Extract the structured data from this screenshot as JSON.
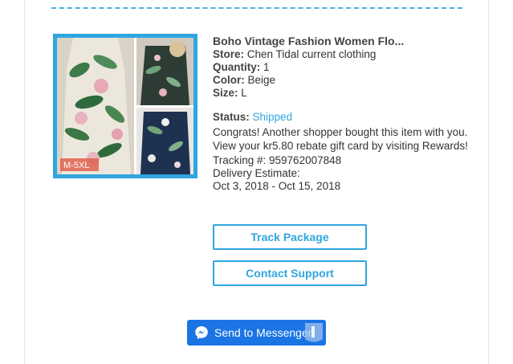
{
  "order_item": {
    "title": "Boho Vintage Fashion Women Flo...",
    "store_label": "Store:",
    "store": "Chen Tidal current clothing",
    "quantity_label": "Quantity:",
    "quantity": "1",
    "color_label": "Color:",
    "color": "Beige",
    "size_label": "Size:",
    "size": "L",
    "status_label": "Status:",
    "status": "Shipped",
    "message": "Congrats! Another shopper bought this item with you. View your kr5.80 rebate gift card by visiting Rewards!",
    "tracking": "Tracking #: 959762007848",
    "delivery_label": "Delivery Estimate:",
    "delivery_range": "Oct 3, 2018 - Oct 15, 2018",
    "image_badge": "M-5XL"
  },
  "buttons": {
    "track_package": "Track Package",
    "contact_support": "Contact Support",
    "send_to_messenger": "Send to Messenger"
  },
  "colors": {
    "accent": "#2fa6df",
    "messenger_blue": "#1b74e4",
    "dash": "#4fb3e2"
  },
  "icons": {
    "messenger": "messenger-icon"
  }
}
